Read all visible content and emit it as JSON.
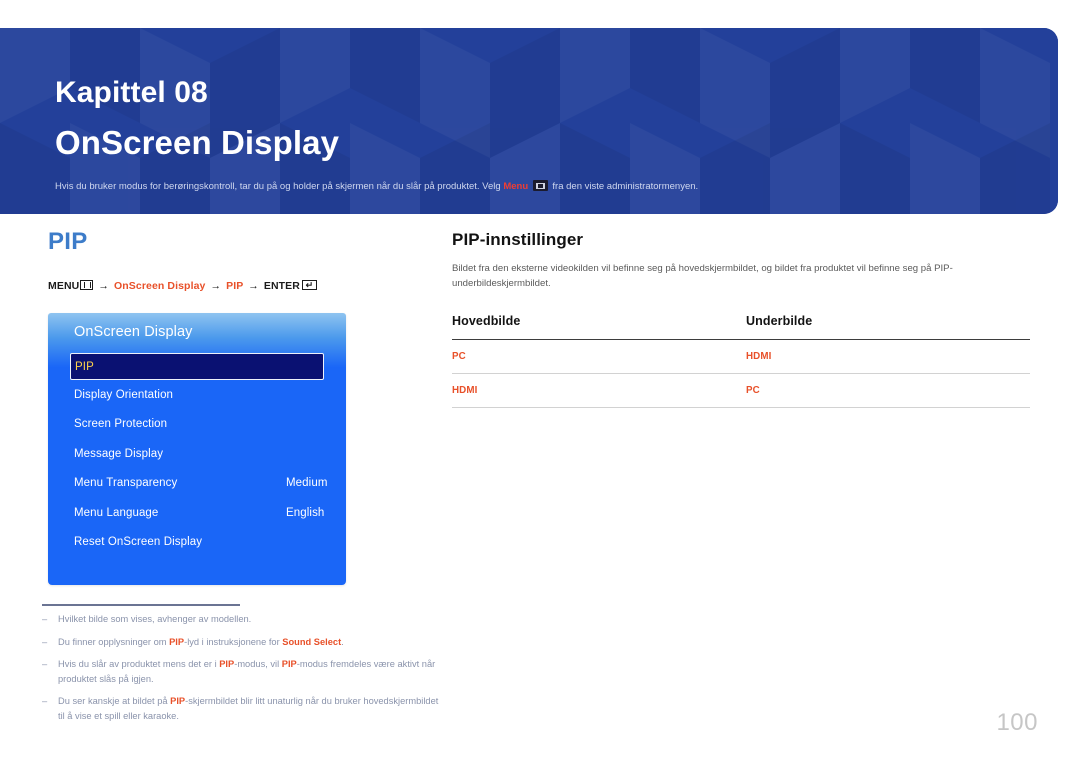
{
  "header": {
    "chapter_label": "Kapittel 08",
    "chapter_title": "OnScreen Display",
    "note_before": "Hvis du bruker modus for berøringskontroll, tar du på og holder på skjermen når du slår på produktet. Velg",
    "note_highlight": "Menu",
    "note_after": "fra den viste administratormenyen.",
    "badge_icon": "menu-icon",
    "background_color": "#23409a"
  },
  "left": {
    "section_heading": "PIP",
    "section_heading_color": "#3d7cc9",
    "menu_path": {
      "root_label": "MENU",
      "root_icon": "menu-icon",
      "step1": "OnScreen Display",
      "step2": "PIP",
      "enter_label": "ENTER",
      "enter_icon": "enter-icon",
      "arrow": "→",
      "accent_color": "#e8512a"
    },
    "osd_panel": {
      "title": "OnScreen Display",
      "selected_index": 0,
      "highlight_text_color": "#ffd24a",
      "rows": [
        {
          "label": "PIP",
          "value": ""
        },
        {
          "label": "Display Orientation",
          "value": ""
        },
        {
          "label": "Screen Protection",
          "value": ""
        },
        {
          "label": "Message Display",
          "value": ""
        },
        {
          "label": "Menu Transparency",
          "value": "Medium"
        },
        {
          "label": "Menu Language",
          "value": "English"
        },
        {
          "label": "Reset OnScreen Display",
          "value": ""
        }
      ]
    },
    "footnotes": [
      {
        "marker": "–",
        "text": "Hvilket bilde som vises, avhenger av modellen."
      },
      {
        "marker": "–",
        "text": "Du finner opplysninger om PIP-lyd i instruksjonene for Sound Select."
      },
      {
        "marker": "–",
        "text": "Hvis du slår av produktet mens det er i PIP-modus, vil PIP-modus fremdeles være aktivt når produktet slås på igjen."
      },
      {
        "marker": "–",
        "text": "Du ser kanskje at bildet på PIP-skjermbildet blir litt unaturlig når du bruker hovedskjermbildet til å vise et spill eller karaoke."
      }
    ]
  },
  "right": {
    "heading": "PIP-innstillinger",
    "body": "Bildet fra den eksterne videokilden vil befinne seg på hovedskjermbildet, og bildet fra produktet vil befinne seg på PIP-underbildeskjermbildet.",
    "table": {
      "headers": [
        "Hovedbilde",
        "Underbilde"
      ],
      "rows": [
        [
          "PC",
          "HDMI"
        ],
        [
          "HDMI",
          "PC"
        ]
      ],
      "value_color": "#e8512a"
    }
  },
  "page_number": "100"
}
